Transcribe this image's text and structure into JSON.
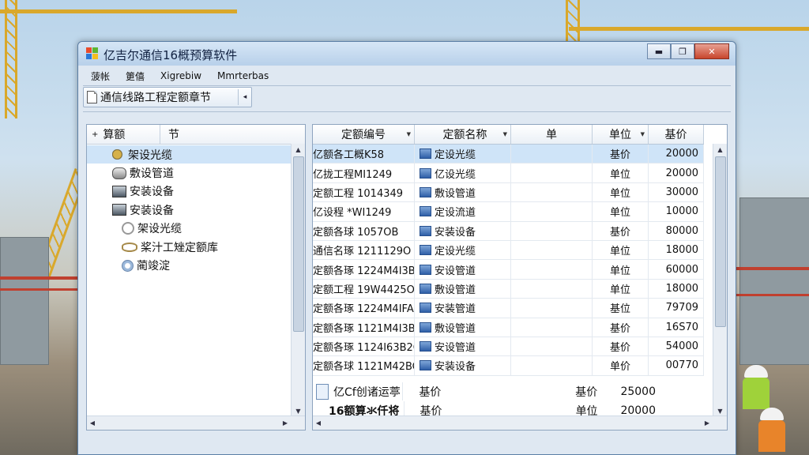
{
  "window": {
    "title": "亿吉尔通信16概预算软件",
    "controls": {
      "minimize": "▬",
      "maximize": "❐",
      "close": "✕"
    }
  },
  "menu": [
    "菠帐",
    "筻僖",
    "Xigrebiw",
    "Mmrterbas"
  ],
  "toolbar": {
    "label": "通信线路工程定额章节"
  },
  "tree": {
    "headers": [
      "算额",
      "节"
    ],
    "items": [
      {
        "label": "架设光缆",
        "icon": "cable-reel-icon",
        "selected": true
      },
      {
        "label": "敷设管道",
        "icon": "pipe-icon",
        "selected": false
      },
      {
        "label": "安装设备",
        "icon": "equipment-icon",
        "selected": false
      },
      {
        "label": "安装设备",
        "icon": "equipment-icon",
        "selected": false
      },
      {
        "label": "架设光缆",
        "icon": "coil-icon",
        "selected": false
      },
      {
        "label": "桨汁工矬定额库",
        "icon": "cable-icon",
        "selected": false
      },
      {
        "label": "蔺竣淀",
        "icon": "disc-icon",
        "selected": false
      }
    ]
  },
  "table": {
    "headers": [
      "定额编号",
      "定额名称",
      "单",
      "单位",
      "基价"
    ],
    "rows": [
      {
        "code": "亿额各工概K58",
        "name": "定设光缆",
        "unit": "基价",
        "price": "20000",
        "selected": true
      },
      {
        "code": "亿拢工程MI1249",
        "name": "亿设光缆",
        "unit": "单位",
        "price": "20000",
        "selected": false
      },
      {
        "code": "定额工程 1014349",
        "name": "敷设管道",
        "unit": "单位",
        "price": "30000",
        "selected": false
      },
      {
        "code": "亿设程 *WI1249",
        "name": "定设流道",
        "unit": "单位",
        "price": "10000",
        "selected": false
      },
      {
        "code": "定额各球 1057OB",
        "name": "安装设备",
        "unit": "基价",
        "price": "80000",
        "selected": false
      },
      {
        "code": "通信名琢 1211129O",
        "name": "定设光缆",
        "unit": "单位",
        "price": "18000",
        "selected": false
      },
      {
        "code": "定额各琢 1224M4I3BIG",
        "name": "安设管道",
        "unit": "单位",
        "price": "60000",
        "selected": false
      },
      {
        "code": "定额工程 19W4425O",
        "name": "敷设管道",
        "unit": "单位",
        "price": "18000",
        "selected": false
      },
      {
        "code": "定额各琢 1224M4IFA.",
        "name": "安装管道",
        "unit": "基位",
        "price": "79709",
        "selected": false
      },
      {
        "code": "定额各琢 1121M4I3Bo",
        "name": "敷设管道",
        "unit": "基价",
        "price": "16S70",
        "selected": false
      },
      {
        "code": "定额各琢 1124I63B2O",
        "name": "安设管道",
        "unit": "基价",
        "price": "54000",
        "selected": false
      },
      {
        "code": "定额各球 1121M42BO",
        "name": "安装设备",
        "unit": "单价",
        "price": "00770",
        "selected": false
      }
    ],
    "extra_rows": [
      {
        "code": "亿Cf创诸运葶",
        "col3": "基价",
        "unit": "基价",
        "price": "25000"
      },
      {
        "code": "16额算氺仟将",
        "col3": "基价",
        "unit": "单位",
        "price": "20000"
      }
    ]
  }
}
